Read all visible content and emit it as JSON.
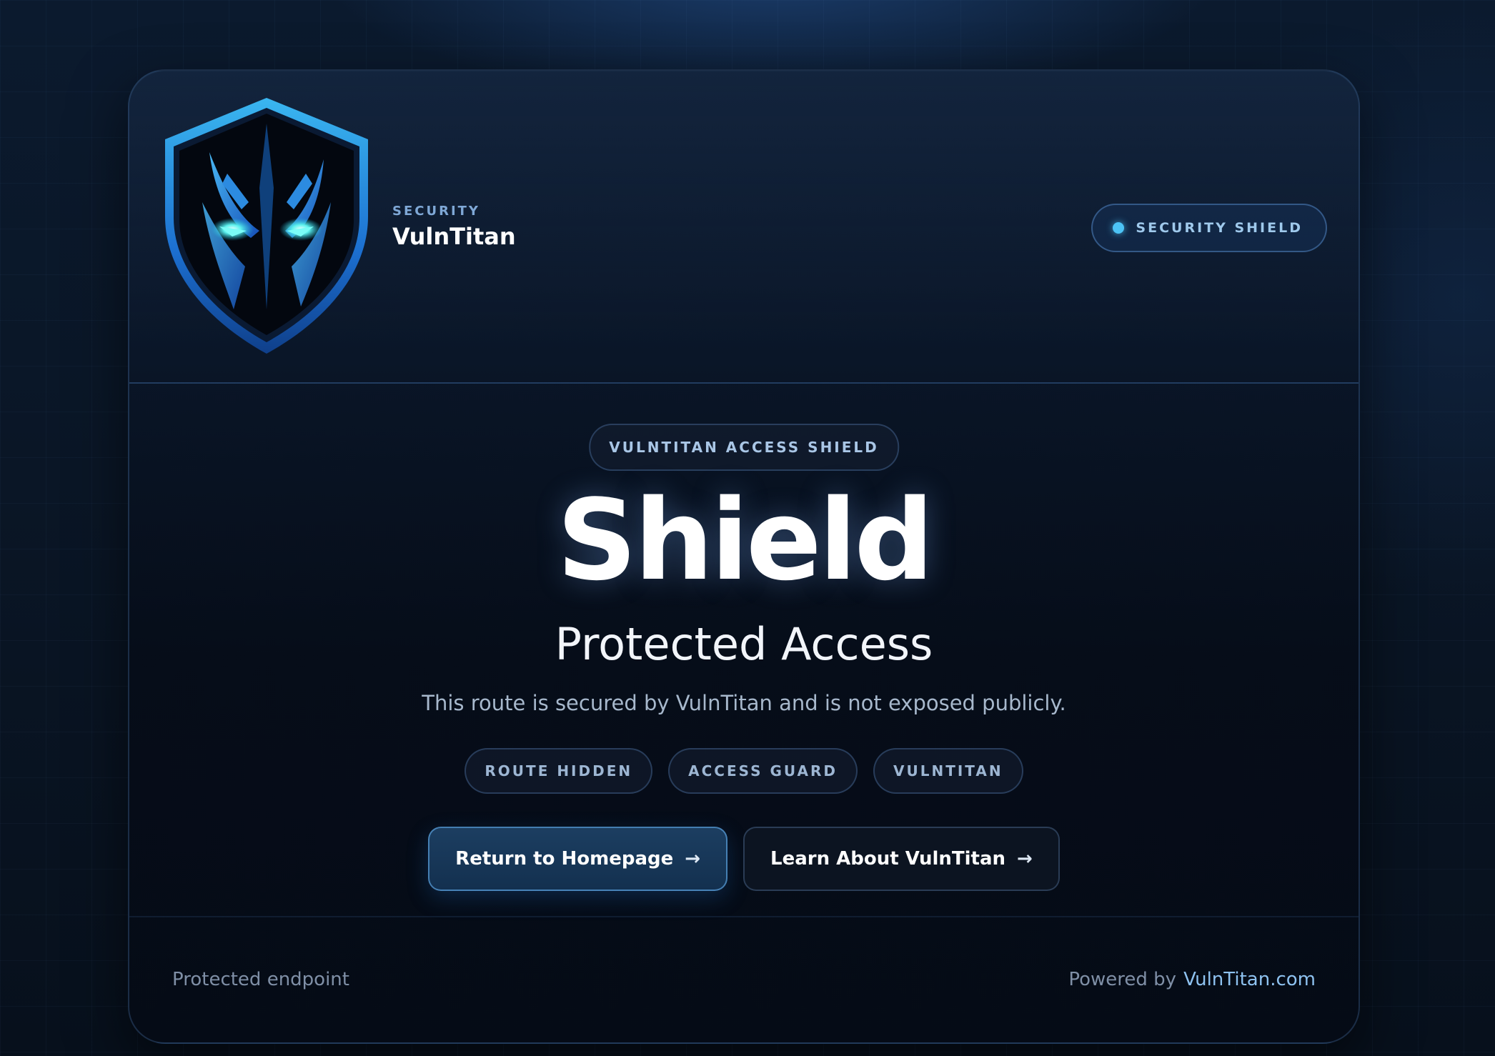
{
  "header": {
    "brand_kicker": "SECURITY",
    "brand_name": "VulnTitan",
    "badge_label": "SECURITY SHIELD",
    "logo_icon": "shield-mask-icon"
  },
  "main": {
    "top_pill": "VULNTITAN ACCESS SHIELD",
    "title": "Shield",
    "subtitle": "Protected Access",
    "description": "This route is secured by VulnTitan and is not exposed publicly.",
    "chips": [
      "ROUTE HIDDEN",
      "ACCESS GUARD",
      "VULNTITAN"
    ],
    "buttons": {
      "primary_label": "Return to Homepage",
      "secondary_label": "Learn About VulnTitan",
      "arrow": "→"
    }
  },
  "footer": {
    "left_text": "Protected endpoint",
    "powered_by": "Powered by",
    "link_text": "VulnTitan.com"
  },
  "colors": {
    "accent": "#4cc3f5",
    "background": "#07101c",
    "text_primary": "#ffffff",
    "text_muted": "#7f8fa6",
    "link": "#8ec2f0"
  }
}
